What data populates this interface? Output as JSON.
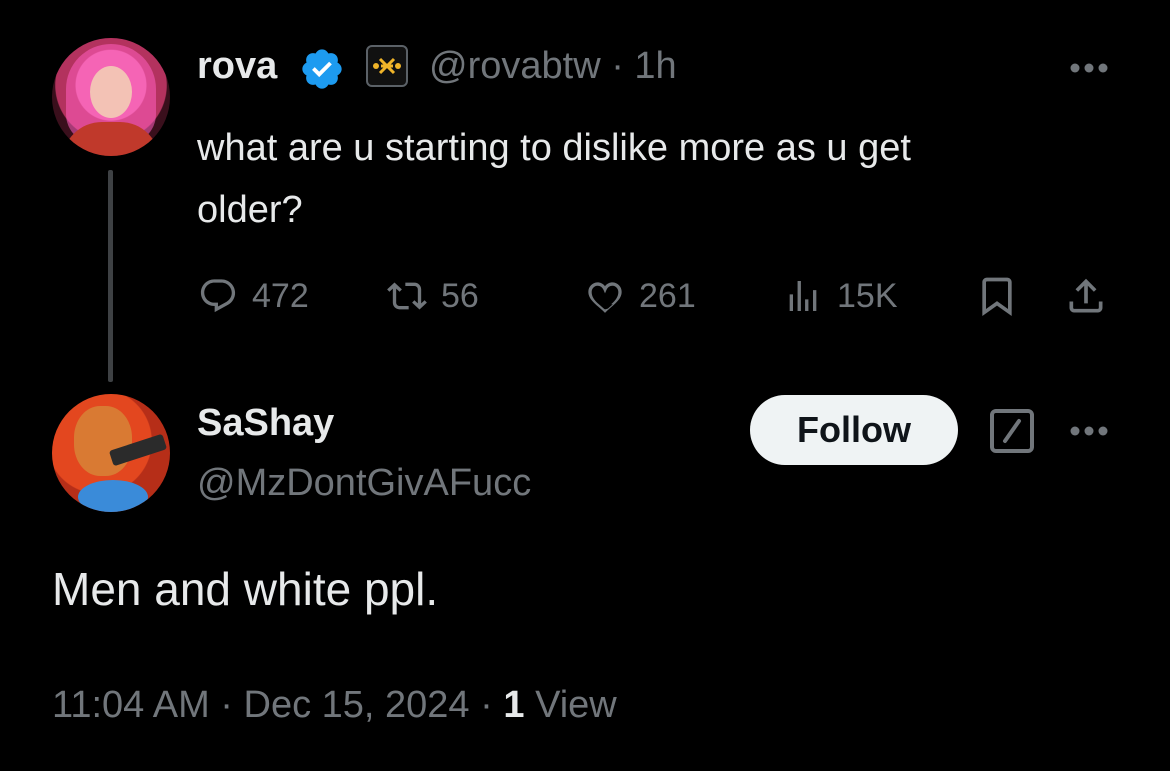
{
  "parent_tweet": {
    "author": {
      "display_name": "rova",
      "handle": "@rovabtw",
      "verified": true,
      "affiliate_badge": "affiliate-icon"
    },
    "separator": "·",
    "time_ago": "1h",
    "text": "what are u starting to dislike more as u get\nolder?",
    "actions": {
      "replies": "472",
      "reposts": "56",
      "likes": "261",
      "views": "15K"
    }
  },
  "reply": {
    "author": {
      "display_name": "SaShay",
      "handle": "@MzDontGivAFucc"
    },
    "follow_label": "Follow",
    "text": "Men and white ppl.",
    "meta": {
      "time": "11:04 AM",
      "date": "Dec 15, 2024",
      "separator": "·",
      "views_count": "1",
      "views_label": "View"
    }
  },
  "colors": {
    "background": "#000000",
    "text_primary": "#e7e9ea",
    "text_secondary": "#71767b",
    "verified_blue": "#1d9bf0",
    "follow_button_bg": "#eff3f4"
  }
}
